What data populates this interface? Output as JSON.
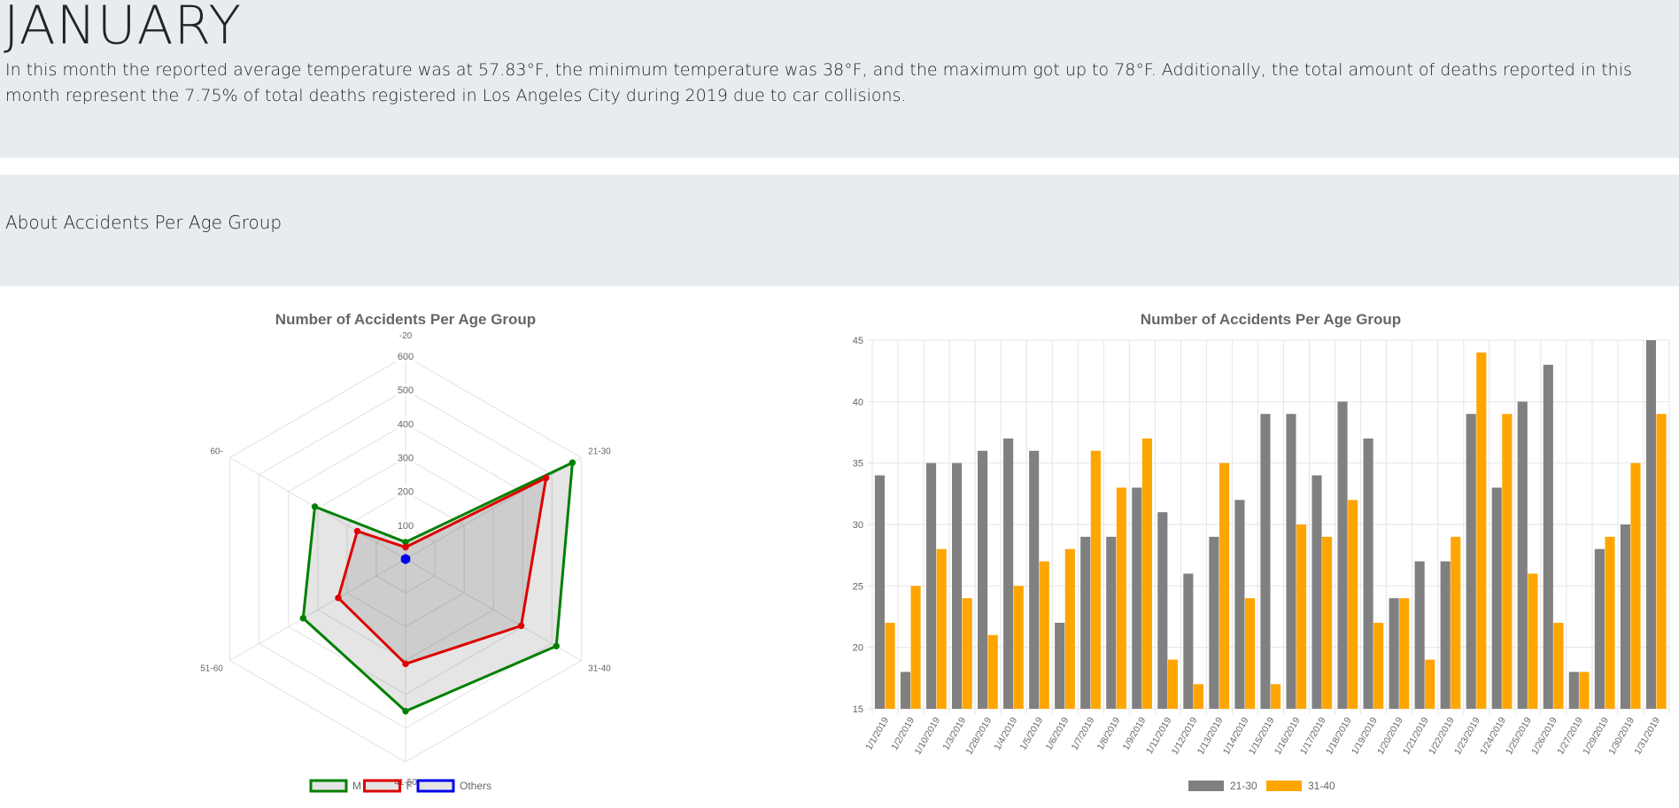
{
  "header": {
    "title": "JANUARY",
    "description": "In this month the reported average temperature was at 57.83°F, the minimum temperature was 38°F, and the maximum got up to 78°F. Additionally, the total amount of deaths reported in this month represent the 7.75% of total deaths registered in Los Angeles City during 2019 due to car collisions."
  },
  "section": {
    "title": "About Accidents Per Age Group"
  },
  "chart_data": [
    {
      "type": "radar",
      "title": "Number of Accidents Per Age Group",
      "labels": [
        "-20",
        "21-30",
        "31-40",
        "41-50",
        "51-60",
        "60-"
      ],
      "r_ticks": [
        100,
        200,
        300,
        400,
        500,
        600
      ],
      "r_max": 600,
      "series": [
        {
          "name": "M",
          "color": "#008000",
          "values": [
            50,
            570,
            515,
            450,
            350,
            310
          ]
        },
        {
          "name": "F",
          "color": "#dd0000",
          "values": [
            35,
            480,
            395,
            310,
            230,
            165
          ]
        },
        {
          "name": "Others",
          "color": "#0000ee",
          "values": [
            5,
            5,
            5,
            5,
            5,
            5
          ]
        }
      ],
      "legend_position": "bottom"
    },
    {
      "type": "bar",
      "title": "Number of Accidents Per Age Group",
      "categories": [
        "1/1/2019",
        "1/2/2019",
        "1/10/2019",
        "1/3/2019",
        "1/28/2019",
        "1/4/2019",
        "1/5/2019",
        "1/6/2019",
        "1/7/2019",
        "1/8/2019",
        "1/9/2019",
        "1/11/2019",
        "1/12/2019",
        "1/13/2019",
        "1/14/2019",
        "1/15/2019",
        "1/16/2019",
        "1/17/2019",
        "1/18/2019",
        "1/19/2019",
        "1/20/2019",
        "1/21/2019",
        "1/22/2019",
        "1/23/2019",
        "1/24/2019",
        "1/25/2019",
        "1/26/2019",
        "1/27/2019",
        "1/29/2019",
        "1/30/2019",
        "1/31/2019"
      ],
      "series": [
        {
          "name": "21-30",
          "color": "#808080",
          "values": [
            34,
            18,
            35,
            35,
            36,
            37,
            36,
            22,
            29,
            29,
            33,
            31,
            26,
            29,
            32,
            39,
            39,
            34,
            40,
            37,
            24,
            27,
            27,
            39,
            33,
            40,
            43,
            18,
            28,
            30,
            45
          ]
        },
        {
          "name": "31-40",
          "color": "#ffa500",
          "values": [
            22,
            25,
            28,
            24,
            21,
            25,
            27,
            28,
            36,
            33,
            37,
            19,
            17,
            35,
            24,
            17,
            30,
            29,
            32,
            22,
            24,
            19,
            29,
            44,
            39,
            26,
            22,
            18,
            29,
            35,
            39
          ]
        }
      ],
      "y_ticks": [
        15,
        20,
        25,
        30,
        35,
        40,
        45
      ],
      "ylim": [
        15,
        45
      ],
      "grid": true,
      "legend_position": "bottom"
    }
  ]
}
